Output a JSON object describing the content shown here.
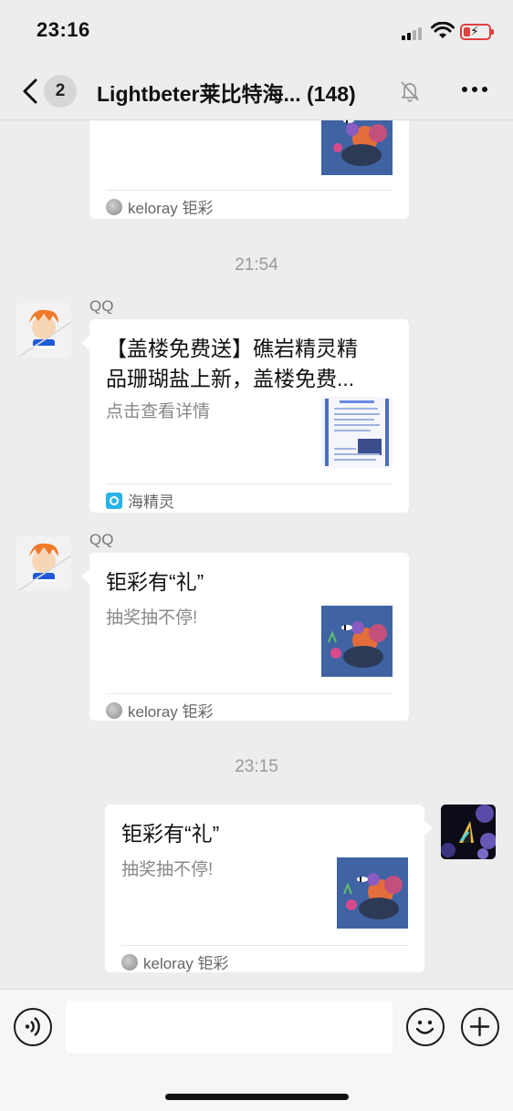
{
  "status_bar": {
    "time": "23:16"
  },
  "nav": {
    "back_count": "2",
    "title": "Lightbeter莱比特海...",
    "member_count": "(148)",
    "icons": [
      "back-chevron-icon",
      "mute-bell-icon",
      "more-icon"
    ]
  },
  "messages": [
    {
      "type": "card",
      "partial": true,
      "source": "keloray 钜彩",
      "thumbnail": "coral-reef"
    },
    {
      "type": "timestamp",
      "text": "21:54"
    },
    {
      "type": "card",
      "sender": "QQ",
      "title": "【盖楼免费送】礁岩精灵精品珊瑚盐上新，盖楼免费...",
      "title_line1": "【盖楼免费送】礁岩精灵精",
      "title_line2": "品珊瑚盐上新，盖楼免费...",
      "desc": "点击查看详情",
      "source": "海精灵",
      "thumbnail": "document"
    },
    {
      "type": "card",
      "sender": "QQ",
      "title": "钜彩有“礼”",
      "desc": "抽奖抽不停!",
      "source": "keloray 钜彩",
      "thumbnail": "coral-reef"
    },
    {
      "type": "timestamp",
      "text": "23:15"
    },
    {
      "type": "card",
      "sender": "self",
      "title": "钜彩有“礼”",
      "desc": "抽奖抽不停!",
      "source": "keloray 钜彩",
      "thumbnail": "coral-reef"
    }
  ],
  "input_bar": {
    "input_value": "",
    "icons": [
      "voice-icon",
      "emoji-icon",
      "plus-icon"
    ]
  },
  "colors": {
    "background": "#ededed",
    "card": "#ffffff",
    "battery": "#e04040",
    "muted_text": "#888888"
  }
}
